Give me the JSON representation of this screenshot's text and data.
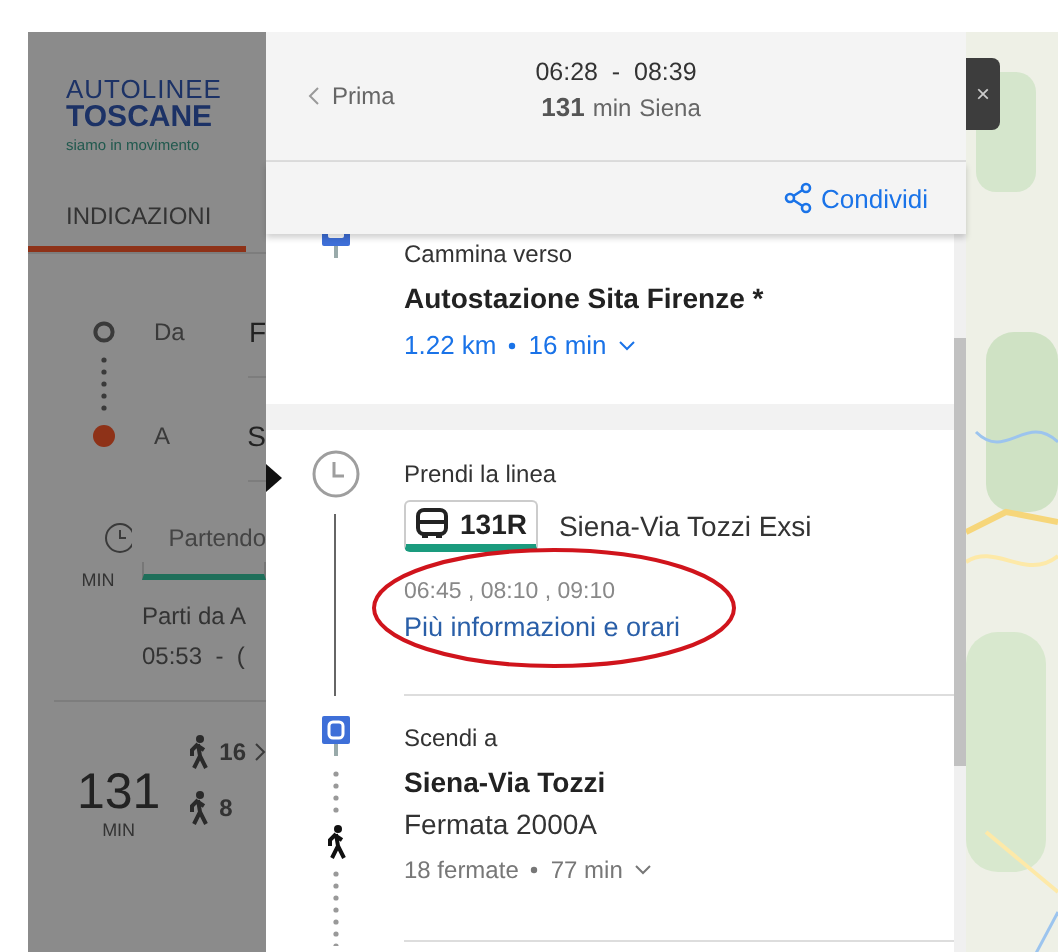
{
  "sidebar": {
    "logo": {
      "line1": "AUTOLINEE",
      "line2": "TOSCANE",
      "tagline": "siamo in movimento"
    },
    "tab": {
      "label": "INDICAZIONI",
      "selected": true
    },
    "from": {
      "label": "Da",
      "value": "F"
    },
    "to": {
      "label": "A",
      "value": "S"
    },
    "departure": "Partendo",
    "routes": [
      {
        "kind": "bus",
        "unit": "MIN",
        "text1": "Parti da A",
        "text2": "05:53  -  ("
      },
      {
        "kind": "walk",
        "minutes": "131",
        "unit": "MIN",
        "walk1": "16",
        "walk2": "8"
      }
    ]
  },
  "close": "×",
  "modal": {
    "back": "Prima",
    "times": "06:28  -  08:39",
    "duration": "131",
    "duration_unit": "min",
    "destination": "Siena",
    "share": "Condividi",
    "steps": [
      {
        "kind": "walk",
        "action": "Cammina verso",
        "place": "Autostazione Sita Firenze *",
        "distance": "1.22 km",
        "time": "16 min"
      },
      {
        "kind": "transit",
        "action": "Prendi la linea",
        "line": "131R",
        "color": "#1a9b7e",
        "headsign": "Siena-Via Tozzi Exsi",
        "times": "06:45 , 08:10 , 09:10",
        "link": "Più informazioni e orari",
        "highlighted": true
      },
      {
        "kind": "alight",
        "action": "Scendi a",
        "place": "Siena-Via Tozzi",
        "stop": "Fermata 2000A",
        "stops": "18 fermate",
        "time": "77 min"
      }
    ]
  }
}
